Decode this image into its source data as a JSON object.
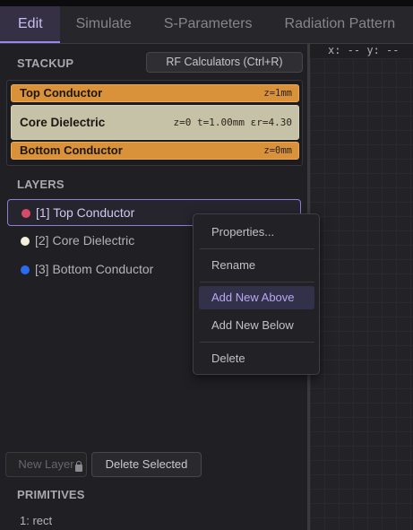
{
  "tabs": [
    "Edit",
    "Simulate",
    "S-Parameters",
    "Radiation Pattern"
  ],
  "canvas": {
    "coord_readout": "x: --  y: --"
  },
  "stackup": {
    "title": "STACKUP",
    "rf_button": "RF Calculators (Ctrl+R)",
    "rows": [
      {
        "name": "Top Conductor",
        "tag": "z=1mm",
        "color": "#d9923a"
      },
      {
        "name": "Core Dielectric",
        "tag": "z=0  t=1.00mm  εr=4.30",
        "color": "#c6c2a8"
      },
      {
        "name": "Bottom Conductor",
        "tag": "z=0mm",
        "color": "#d9923a"
      }
    ]
  },
  "layers": {
    "title": "LAYERS",
    "items": [
      {
        "label": "[1] Top Conductor",
        "color": "#d84a6a",
        "selected": true
      },
      {
        "label": "[2] Core Dielectric",
        "color": "#f4f0dc",
        "selected": false
      },
      {
        "label": "[3] Bottom Conductor",
        "color": "#2a6cf0",
        "selected": false
      }
    ]
  },
  "context_menu": {
    "items": [
      "Properties...",
      "Rename",
      "Add New Above",
      "Add New Below",
      "Delete"
    ],
    "highlighted": "Add New Above"
  },
  "buttons": {
    "new_layer": "New Layer",
    "delete_selected": "Delete Selected"
  },
  "primitives": {
    "title": "PRIMITIVES",
    "items": [
      "1: rect"
    ]
  }
}
